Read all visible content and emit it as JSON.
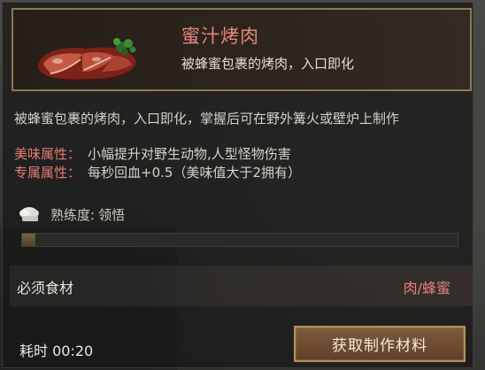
{
  "item": {
    "name": "蜜汁烤肉",
    "short_desc": "被蜂蜜包裹的烤肉，入口即化",
    "icon": "roasted-meat-icon"
  },
  "description": "被蜂蜜包裹的烤肉，入口即化，掌握后可在野外篝火或壁炉上制作",
  "attributes": [
    {
      "label": "美味属性：",
      "value": "小幅提升对野生动物,人型怪物伤害"
    },
    {
      "label": "专属属性：",
      "value": "每秒回血+0.5（美味值大于2拥有）"
    }
  ],
  "proficiency": {
    "label": "熟练度:",
    "value": "领悟",
    "progress_fraction": 0.03,
    "icon": "chef-hat-icon"
  },
  "ingredients": {
    "label": "必须食材",
    "value": "肉/蜂蜜"
  },
  "time": {
    "label": "耗时 00:20"
  },
  "action": {
    "label": "获取制作材料"
  },
  "colors": {
    "accent_red": "#e6857d",
    "frame_gold": "#8a7a55",
    "button_brown": "#7f5a3a"
  }
}
